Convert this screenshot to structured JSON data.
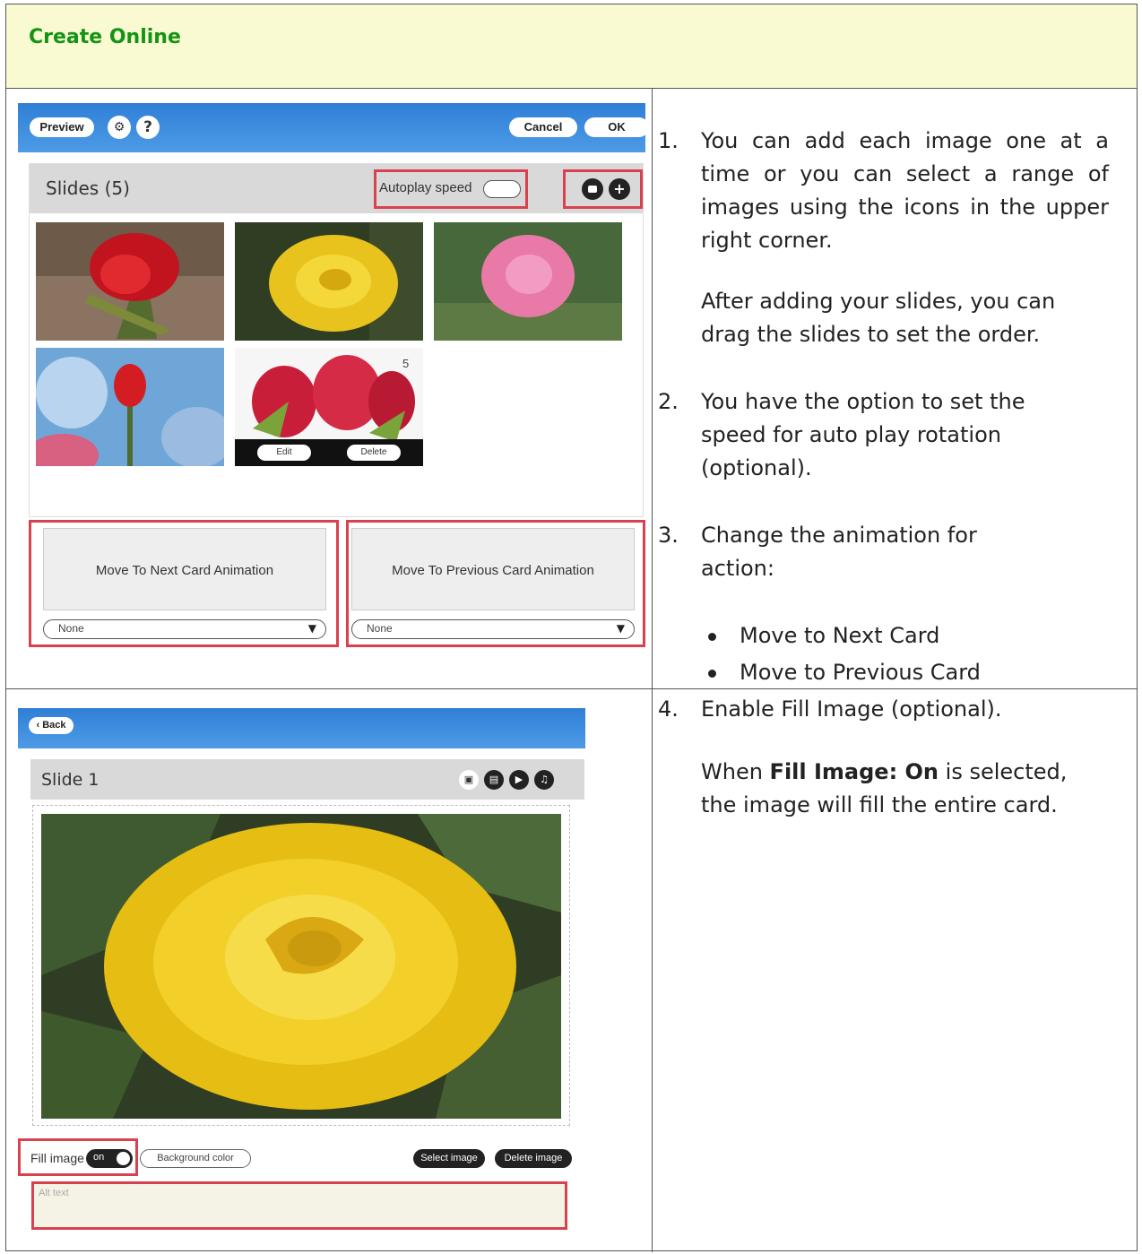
{
  "header": {
    "title": "Create Online"
  },
  "shot1": {
    "toolbar": {
      "preview_label": "Preview",
      "settings_icon": "gear-icon",
      "help_label": "?",
      "cancel_label": "Cancel",
      "ok_label": "OK"
    },
    "slides_title": "Slides (5)",
    "autoplay_label": "Autoplay speed",
    "add_icon": "+",
    "thumb5_number": "5",
    "edit_label": "Edit",
    "delete_label": "Delete",
    "next_anim_label": "Move To Next Card Animation",
    "prev_anim_label": "Move To Previous Card Animation",
    "next_anim_value": "None",
    "prev_anim_value": "None"
  },
  "shot2": {
    "back_label": "Back",
    "slide_title": "Slide 1",
    "fill_label": "Fill image",
    "fill_state": "on",
    "bg_color_label": "Background color",
    "select_image_label": "Select image",
    "delete_image_label": "Delete image",
    "alt_placeholder": "Alt text"
  },
  "steps": {
    "s1_num": "1.",
    "s1_a": "You can add each image one at a time or you can select a range of images using the icons in the upper right corner.",
    "s1_b": "After adding your slides, you can drag the slides to set the order.",
    "s2_num": "2.",
    "s2": "You have the option to set the speed for auto play rotation (optional).",
    "s3_num": "3.",
    "s3": "Change the animation for action:",
    "bullet1": "Move to Next Card",
    "bullet2": "Move to Previous Card",
    "s4_num": "4.",
    "s4": "Enable Fill Image (optional).",
    "s4b_pre": "When ",
    "s4b_bold": "Fill Image: On",
    "s4b_post": " is selected, the image will fill the entire card."
  },
  "colors": {
    "header_bg": "#fafad2",
    "title": "#149414",
    "highlight": "#d9414f",
    "toolbar": "#3a88dc"
  }
}
